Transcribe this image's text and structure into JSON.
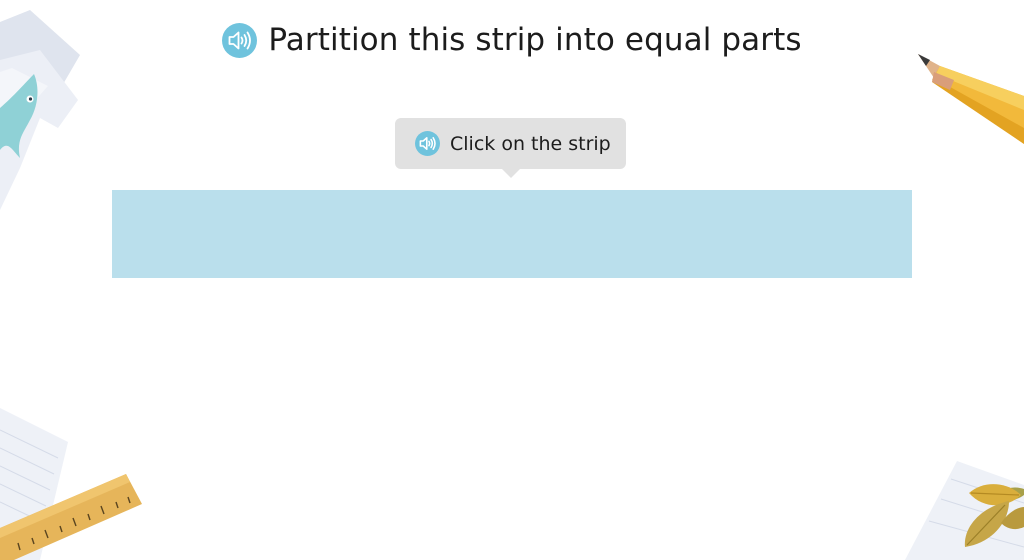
{
  "question": {
    "title": "Partition this strip into equal parts",
    "title_audio_icon": "speaker-icon"
  },
  "hint": {
    "text": "Click on the strip",
    "audio_icon": "speaker-icon"
  },
  "strip": {
    "color": "#badfec",
    "parts": 1
  },
  "colors": {
    "audio_icon_bg": "#6fc3dd",
    "tooltip_bg": "#e1e1e1"
  },
  "decorations": [
    "paper-with-whale-illustration",
    "pencil",
    "ruler-on-paper",
    "leaves-on-paper"
  ]
}
